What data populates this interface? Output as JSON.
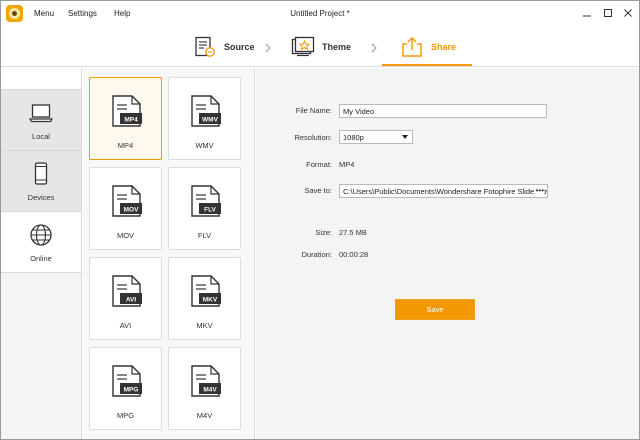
{
  "app": {
    "title": "Untitled Project *",
    "menu": [
      {
        "label": "Menu"
      },
      {
        "label": "Settings"
      },
      {
        "label": "Help"
      }
    ]
  },
  "steps": [
    {
      "label": "Source",
      "icon": "source-icon",
      "active": false
    },
    {
      "label": "Theme",
      "icon": "theme-icon",
      "active": false
    },
    {
      "label": "Share",
      "icon": "share-icon",
      "active": true
    }
  ],
  "nav": {
    "items": [
      {
        "label": "Local",
        "icon": "laptop-icon",
        "selected": true
      },
      {
        "label": "Devices",
        "icon": "phone-icon",
        "selected": false
      },
      {
        "label": "Online",
        "icon": "globe-icon",
        "selected": false
      }
    ]
  },
  "formats": [
    {
      "label": "MP4",
      "badge": "MP4",
      "selected": true
    },
    {
      "label": "WMV",
      "badge": "WMV",
      "selected": false
    },
    {
      "label": "MOV",
      "badge": "MOV",
      "selected": false
    },
    {
      "label": "FLV",
      "badge": "FLV",
      "selected": false
    },
    {
      "label": "AVI",
      "badge": "AVI",
      "selected": false
    },
    {
      "label": "MKV",
      "badge": "MKV",
      "selected": false
    },
    {
      "label": "MPG",
      "badge": "MPG",
      "selected": false
    },
    {
      "label": "M4V",
      "badge": "M4V",
      "selected": false
    }
  ],
  "settings": {
    "file_name_label": "File Name:",
    "file_name_value": "My Video",
    "resolution_label": "Resolution:",
    "resolution_value": "1080p",
    "format_label": "Format:",
    "format_value": "MP4",
    "save_to_label": "Save to:",
    "save_to_value": "C:\\Users\\Public\\Documents\\Wondershare Fotophire Slideshow",
    "browse_label": "•••",
    "size_label": "Size:",
    "size_value": "27.5 MB",
    "duration_label": "Duration:",
    "duration_value": "00:00:28",
    "save_button": "Save"
  },
  "colors": {
    "accent": "#f39800",
    "selected_card_bg": "#fff8ef"
  }
}
